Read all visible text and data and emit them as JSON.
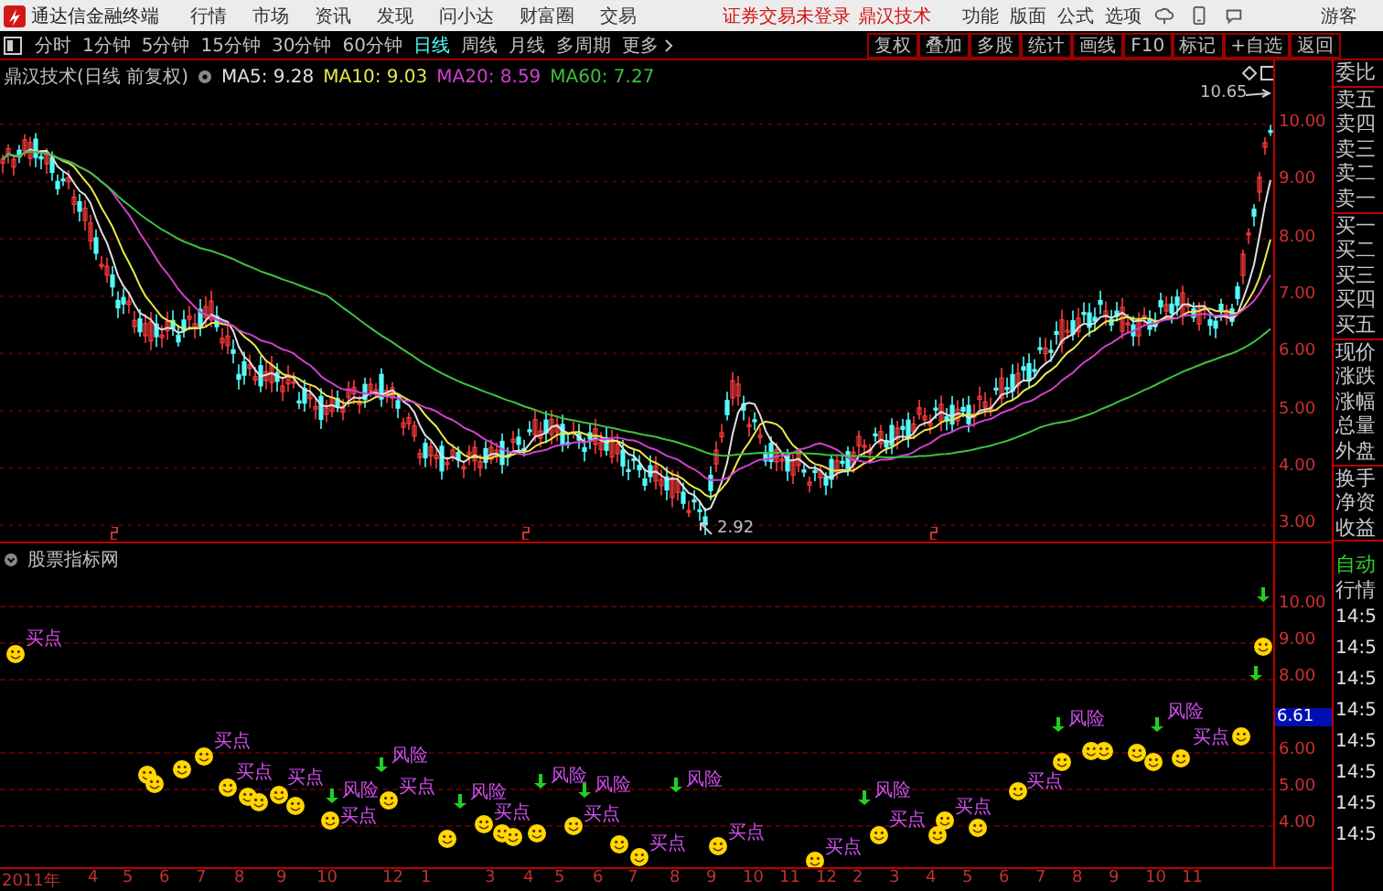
{
  "app": {
    "title": "通达信金融终端",
    "menu": [
      "行情",
      "市场",
      "资讯",
      "发现",
      "问小达",
      "财富圈",
      "交易"
    ],
    "login_status": "证券交易未登录",
    "stock_name": "鼎汉技术",
    "right_menu": [
      "功能",
      "版面",
      "公式",
      "选项"
    ],
    "user": "游客"
  },
  "periods": [
    {
      "label": "分时",
      "selected": false
    },
    {
      "label": "1分钟",
      "selected": false
    },
    {
      "label": "5分钟",
      "selected": false
    },
    {
      "label": "15分钟",
      "selected": false
    },
    {
      "label": "30分钟",
      "selected": false
    },
    {
      "label": "60分钟",
      "selected": false
    },
    {
      "label": "日线",
      "selected": true
    },
    {
      "label": "周线",
      "selected": false
    },
    {
      "label": "月线",
      "selected": false
    },
    {
      "label": "多周期",
      "selected": false
    },
    {
      "label": "更多",
      "selected": false
    }
  ],
  "tools": [
    "复权",
    "叠加",
    "多股",
    "统计",
    "画线",
    "F10",
    "标记",
    "+自选",
    "返回"
  ],
  "chart": {
    "title": "鼎汉技术(日线 前复权)",
    "ma": [
      {
        "label": "MA5: 9.28",
        "color": "#e0e0e0"
      },
      {
        "label": "MA10: 9.03",
        "color": "#e8e84a"
      },
      {
        "label": "MA20: 8.59",
        "color": "#d040d0"
      },
      {
        "label": "MA60: 7.27",
        "color": "#40c040"
      }
    ],
    "price_axis": [
      "10.00",
      "9.00",
      "8.00",
      "7.00",
      "6.00",
      "5.00",
      "4.00",
      "3.00"
    ],
    "high_label": "10.65",
    "low_label": "2.92"
  },
  "indicator": {
    "title": "股票指标网",
    "axis": [
      "10.00",
      "9.00",
      "8.00",
      "6.00",
      "5.00",
      "4.00"
    ],
    "current": "6.61",
    "signals": [
      {
        "kind": "buy",
        "label": "买点"
      },
      {
        "kind": "buy"
      },
      {
        "kind": "buy"
      },
      {
        "kind": "buy"
      },
      {
        "kind": "buy",
        "label": "买点"
      },
      {
        "kind": "buy",
        "label": "买点"
      },
      {
        "kind": "buy"
      },
      {
        "kind": "buy"
      },
      {
        "kind": "buy",
        "label": "买点"
      },
      {
        "kind": "buy"
      },
      {
        "kind": "risk",
        "label": "风险"
      },
      {
        "kind": "buy",
        "label": "买点"
      },
      {
        "kind": "risk",
        "label": "风险"
      },
      {
        "kind": "buy",
        "label": "买点"
      },
      {
        "kind": "buy"
      },
      {
        "kind": "risk",
        "label": "风险"
      },
      {
        "kind": "buy",
        "label": "买点"
      },
      {
        "kind": "buy"
      },
      {
        "kind": "buy"
      },
      {
        "kind": "buy"
      },
      {
        "kind": "risk",
        "label": "风险"
      },
      {
        "kind": "buy",
        "label": "买点"
      },
      {
        "kind": "risk",
        "label": "风险"
      },
      {
        "kind": "buy"
      },
      {
        "kind": "buy",
        "label": "买点"
      },
      {
        "kind": "risk",
        "label": "风险"
      },
      {
        "kind": "buy",
        "label": "买点"
      },
      {
        "kind": "buy",
        "label": "买点"
      },
      {
        "kind": "risk",
        "label": "风险"
      },
      {
        "kind": "buy",
        "label": "买点"
      },
      {
        "kind": "buy"
      },
      {
        "kind": "buy",
        "label": "买点"
      },
      {
        "kind": "buy"
      },
      {
        "kind": "buy",
        "label": "买点"
      },
      {
        "kind": "risk",
        "label": "风险"
      },
      {
        "kind": "buy"
      },
      {
        "kind": "buy"
      },
      {
        "kind": "buy"
      },
      {
        "kind": "buy"
      },
      {
        "kind": "buy"
      },
      {
        "kind": "risk",
        "label": "风险"
      },
      {
        "kind": "buy"
      },
      {
        "kind": "buy",
        "label": "买点"
      },
      {
        "kind": "risk"
      },
      {
        "kind": "buy"
      },
      {
        "kind": "risk"
      }
    ]
  },
  "dates": [
    "2011年",
    "4",
    "5",
    "6",
    "7",
    "8",
    "9",
    "10",
    "12",
    "1",
    "3",
    "4",
    "5",
    "6",
    "7",
    "8",
    "9",
    "10",
    "11",
    "12",
    "2",
    "3",
    "4",
    "5",
    "6",
    "7",
    "8",
    "9",
    "10",
    "11"
  ],
  "quote_panel": {
    "groups": [
      [
        "委比"
      ],
      [
        "卖五",
        "卖四",
        "卖三",
        "卖二",
        "卖一"
      ],
      [
        "买一",
        "买二",
        "买三",
        "买四",
        "买五"
      ],
      [
        "现价",
        "涨跌",
        "涨幅",
        "总量",
        "外盘"
      ],
      [
        "换手",
        "净资",
        "收益"
      ]
    ],
    "mode": "自动",
    "tab": "行情",
    "times": [
      "14:5",
      "14:5",
      "14:5",
      "14:5",
      "14:5",
      "14:5",
      "14:5",
      "14:5"
    ]
  }
}
